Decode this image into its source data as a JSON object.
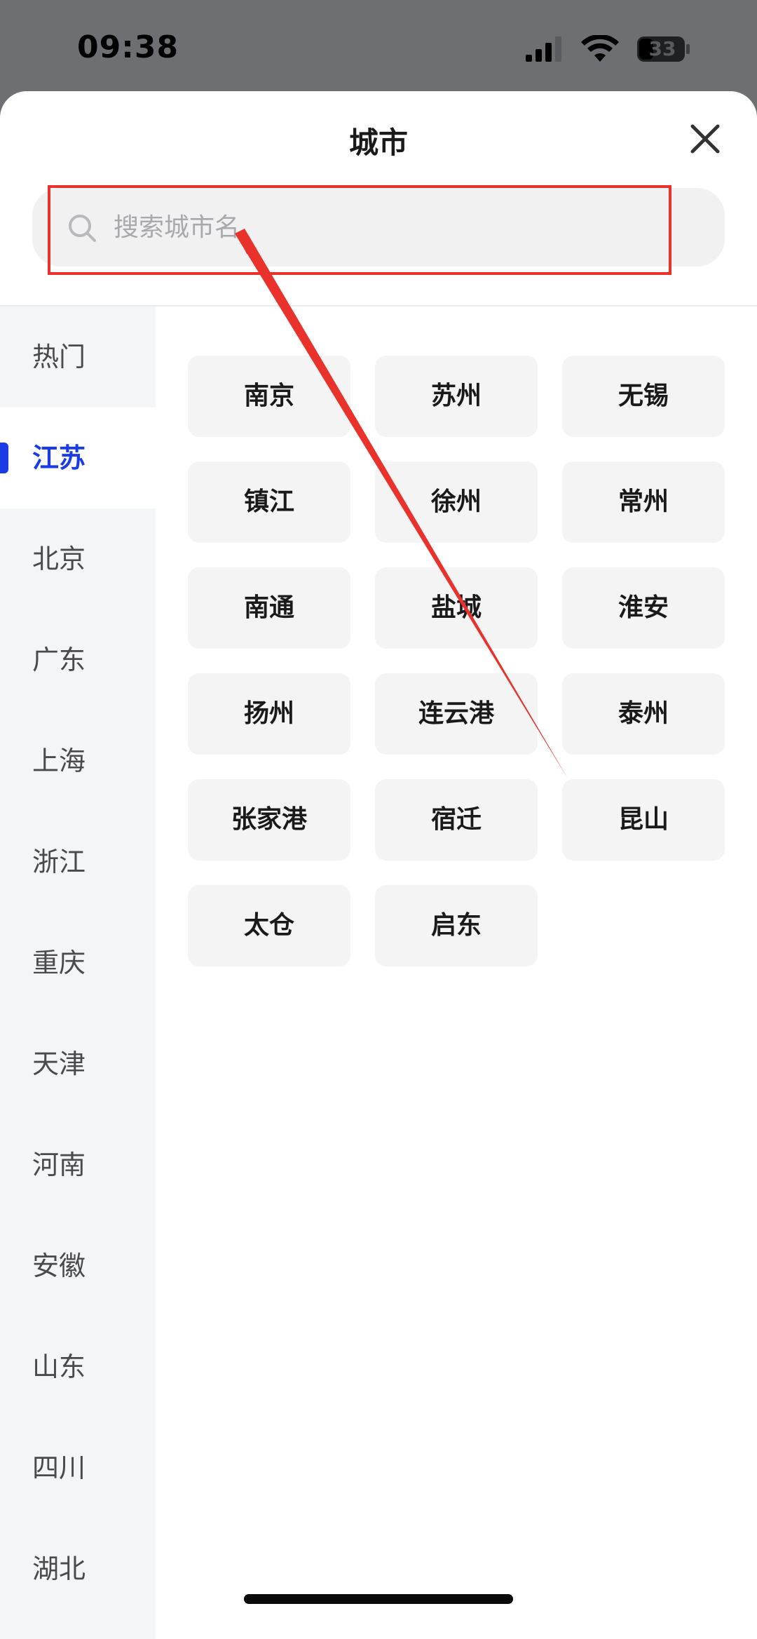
{
  "status_bar": {
    "time": "09:38",
    "battery": "33",
    "icons": [
      "signal-icon",
      "wifi-icon",
      "battery-icon"
    ]
  },
  "sheet": {
    "title": "城市",
    "close_icon": "close-icon"
  },
  "search": {
    "placeholder": "搜索城市名",
    "value": "",
    "icon": "search-icon"
  },
  "provinces": {
    "items": [
      {
        "label": "热门"
      },
      {
        "label": "江苏",
        "active": true
      },
      {
        "label": "北京"
      },
      {
        "label": "广东"
      },
      {
        "label": "上海"
      },
      {
        "label": "浙江"
      },
      {
        "label": "重庆"
      },
      {
        "label": "天津"
      },
      {
        "label": "河南"
      },
      {
        "label": "安徽"
      },
      {
        "label": "山东"
      },
      {
        "label": "四川"
      },
      {
        "label": "湖北"
      }
    ],
    "active_color": "#1a3be6"
  },
  "cities": {
    "items": [
      {
        "label": "南京"
      },
      {
        "label": "苏州"
      },
      {
        "label": "无锡"
      },
      {
        "label": "镇江"
      },
      {
        "label": "徐州"
      },
      {
        "label": "常州"
      },
      {
        "label": "南通"
      },
      {
        "label": "盐城"
      },
      {
        "label": "淮安"
      },
      {
        "label": "扬州"
      },
      {
        "label": "连云港"
      },
      {
        "label": "泰州"
      },
      {
        "label": "张家港"
      },
      {
        "label": "宿迁"
      },
      {
        "label": "昆山"
      },
      {
        "label": "太仓"
      },
      {
        "label": "启东"
      }
    ]
  },
  "annotation": {
    "color": "#e8322b"
  }
}
